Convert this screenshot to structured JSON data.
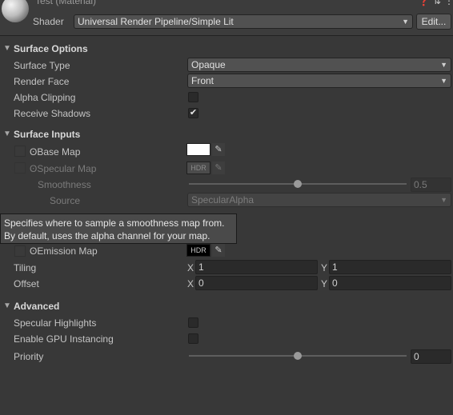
{
  "header": {
    "title": "Test (Material)",
    "shader_label": "Shader",
    "shader_value": "Universal Render Pipeline/Simple Lit",
    "edit_button": "Edit..."
  },
  "surface_options": {
    "title": "Surface Options",
    "surface_type": {
      "label": "Surface Type",
      "value": "Opaque"
    },
    "render_face": {
      "label": "Render Face",
      "value": "Front"
    },
    "alpha_clipping": {
      "label": "Alpha Clipping",
      "checked": false
    },
    "receive_shadows": {
      "label": "Receive Shadows",
      "checked": true
    }
  },
  "surface_inputs": {
    "title": "Surface Inputs",
    "base_map": {
      "label": "Base Map",
      "color": "#ffffff"
    },
    "specular_map": {
      "label": "Specular Map",
      "badge": "HDR"
    },
    "smoothness": {
      "label": "Smoothness",
      "value": "0.5",
      "level": 0.5
    },
    "source": {
      "label": "Source",
      "value": "SpecularAlpha"
    },
    "emission_map": {
      "label": "Emission Map",
      "badge": "HDR"
    },
    "tiling": {
      "label": "Tiling",
      "x_label": "X",
      "x": "1",
      "y_label": "Y",
      "y": "1"
    },
    "offset": {
      "label": "Offset",
      "x_label": "X",
      "x": "0",
      "y_label": "Y",
      "y": "0"
    }
  },
  "tooltip": {
    "line1": "Specifies where to sample a smoothness map from.",
    "line2": "By default, uses the alpha channel for your map."
  },
  "advanced": {
    "title": "Advanced",
    "specular_highlights": {
      "label": "Specular Highlights",
      "checked": false
    },
    "gpu_instancing": {
      "label": "Enable GPU Instancing",
      "checked": false
    },
    "priority": {
      "label": "Priority",
      "value": "0",
      "level": 0.5
    }
  },
  "icons": {
    "help": "help-icon",
    "preset": "preset-icon",
    "menu": "kebab-menu-icon",
    "eyedropper": "eyedropper-icon",
    "foldout": "foldout-triangle-icon"
  }
}
